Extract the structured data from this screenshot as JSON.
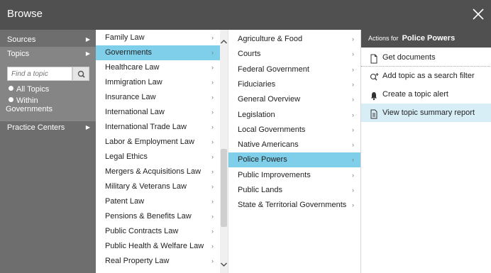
{
  "dialog": {
    "title": "Browse"
  },
  "nav": {
    "sources": "Sources",
    "topics": "Topics",
    "find_placeholder": "Find a topic",
    "radio_all": "All Topics",
    "radio_within_line1": "Within",
    "radio_within_line2": "Governments",
    "practice_centers": "Practice Centers"
  },
  "topics": [
    "Family Law",
    "Governments",
    "Healthcare Law",
    "Immigration Law",
    "Insurance Law",
    "International Law",
    "International Trade Law",
    "Labor & Employment Law",
    "Legal Ethics",
    "Mergers & Acquisitions Law",
    "Military & Veterans Law",
    "Patent Law",
    "Pensions & Benefits Law",
    "Public Contracts Law",
    "Public Health & Welfare Law",
    "Real Property Law"
  ],
  "selected_topic": "Governments",
  "subtopics": [
    "Agriculture & Food",
    "Courts",
    "Federal Government",
    "Fiduciaries",
    "General Overview",
    "Legislation",
    "Local Governments",
    "Native Americans",
    "Police Powers",
    "Public Improvements",
    "Public Lands",
    "State & Territorial Governments"
  ],
  "selected_subtopic": "Police Powers",
  "actions_panel": {
    "header_for": "Actions for",
    "header_name": "Police Powers",
    "get_documents": "Get documents",
    "add_filter": "Add topic as a search filter",
    "create_alert": "Create a topic alert",
    "view_report": "View topic summary report"
  },
  "colors": {
    "titlebar": "#505050",
    "nav_bg": "#6e6e6e",
    "nav_active": "#858585",
    "selected_row": "#7fcfea",
    "action_hover": "#d8eef7"
  }
}
